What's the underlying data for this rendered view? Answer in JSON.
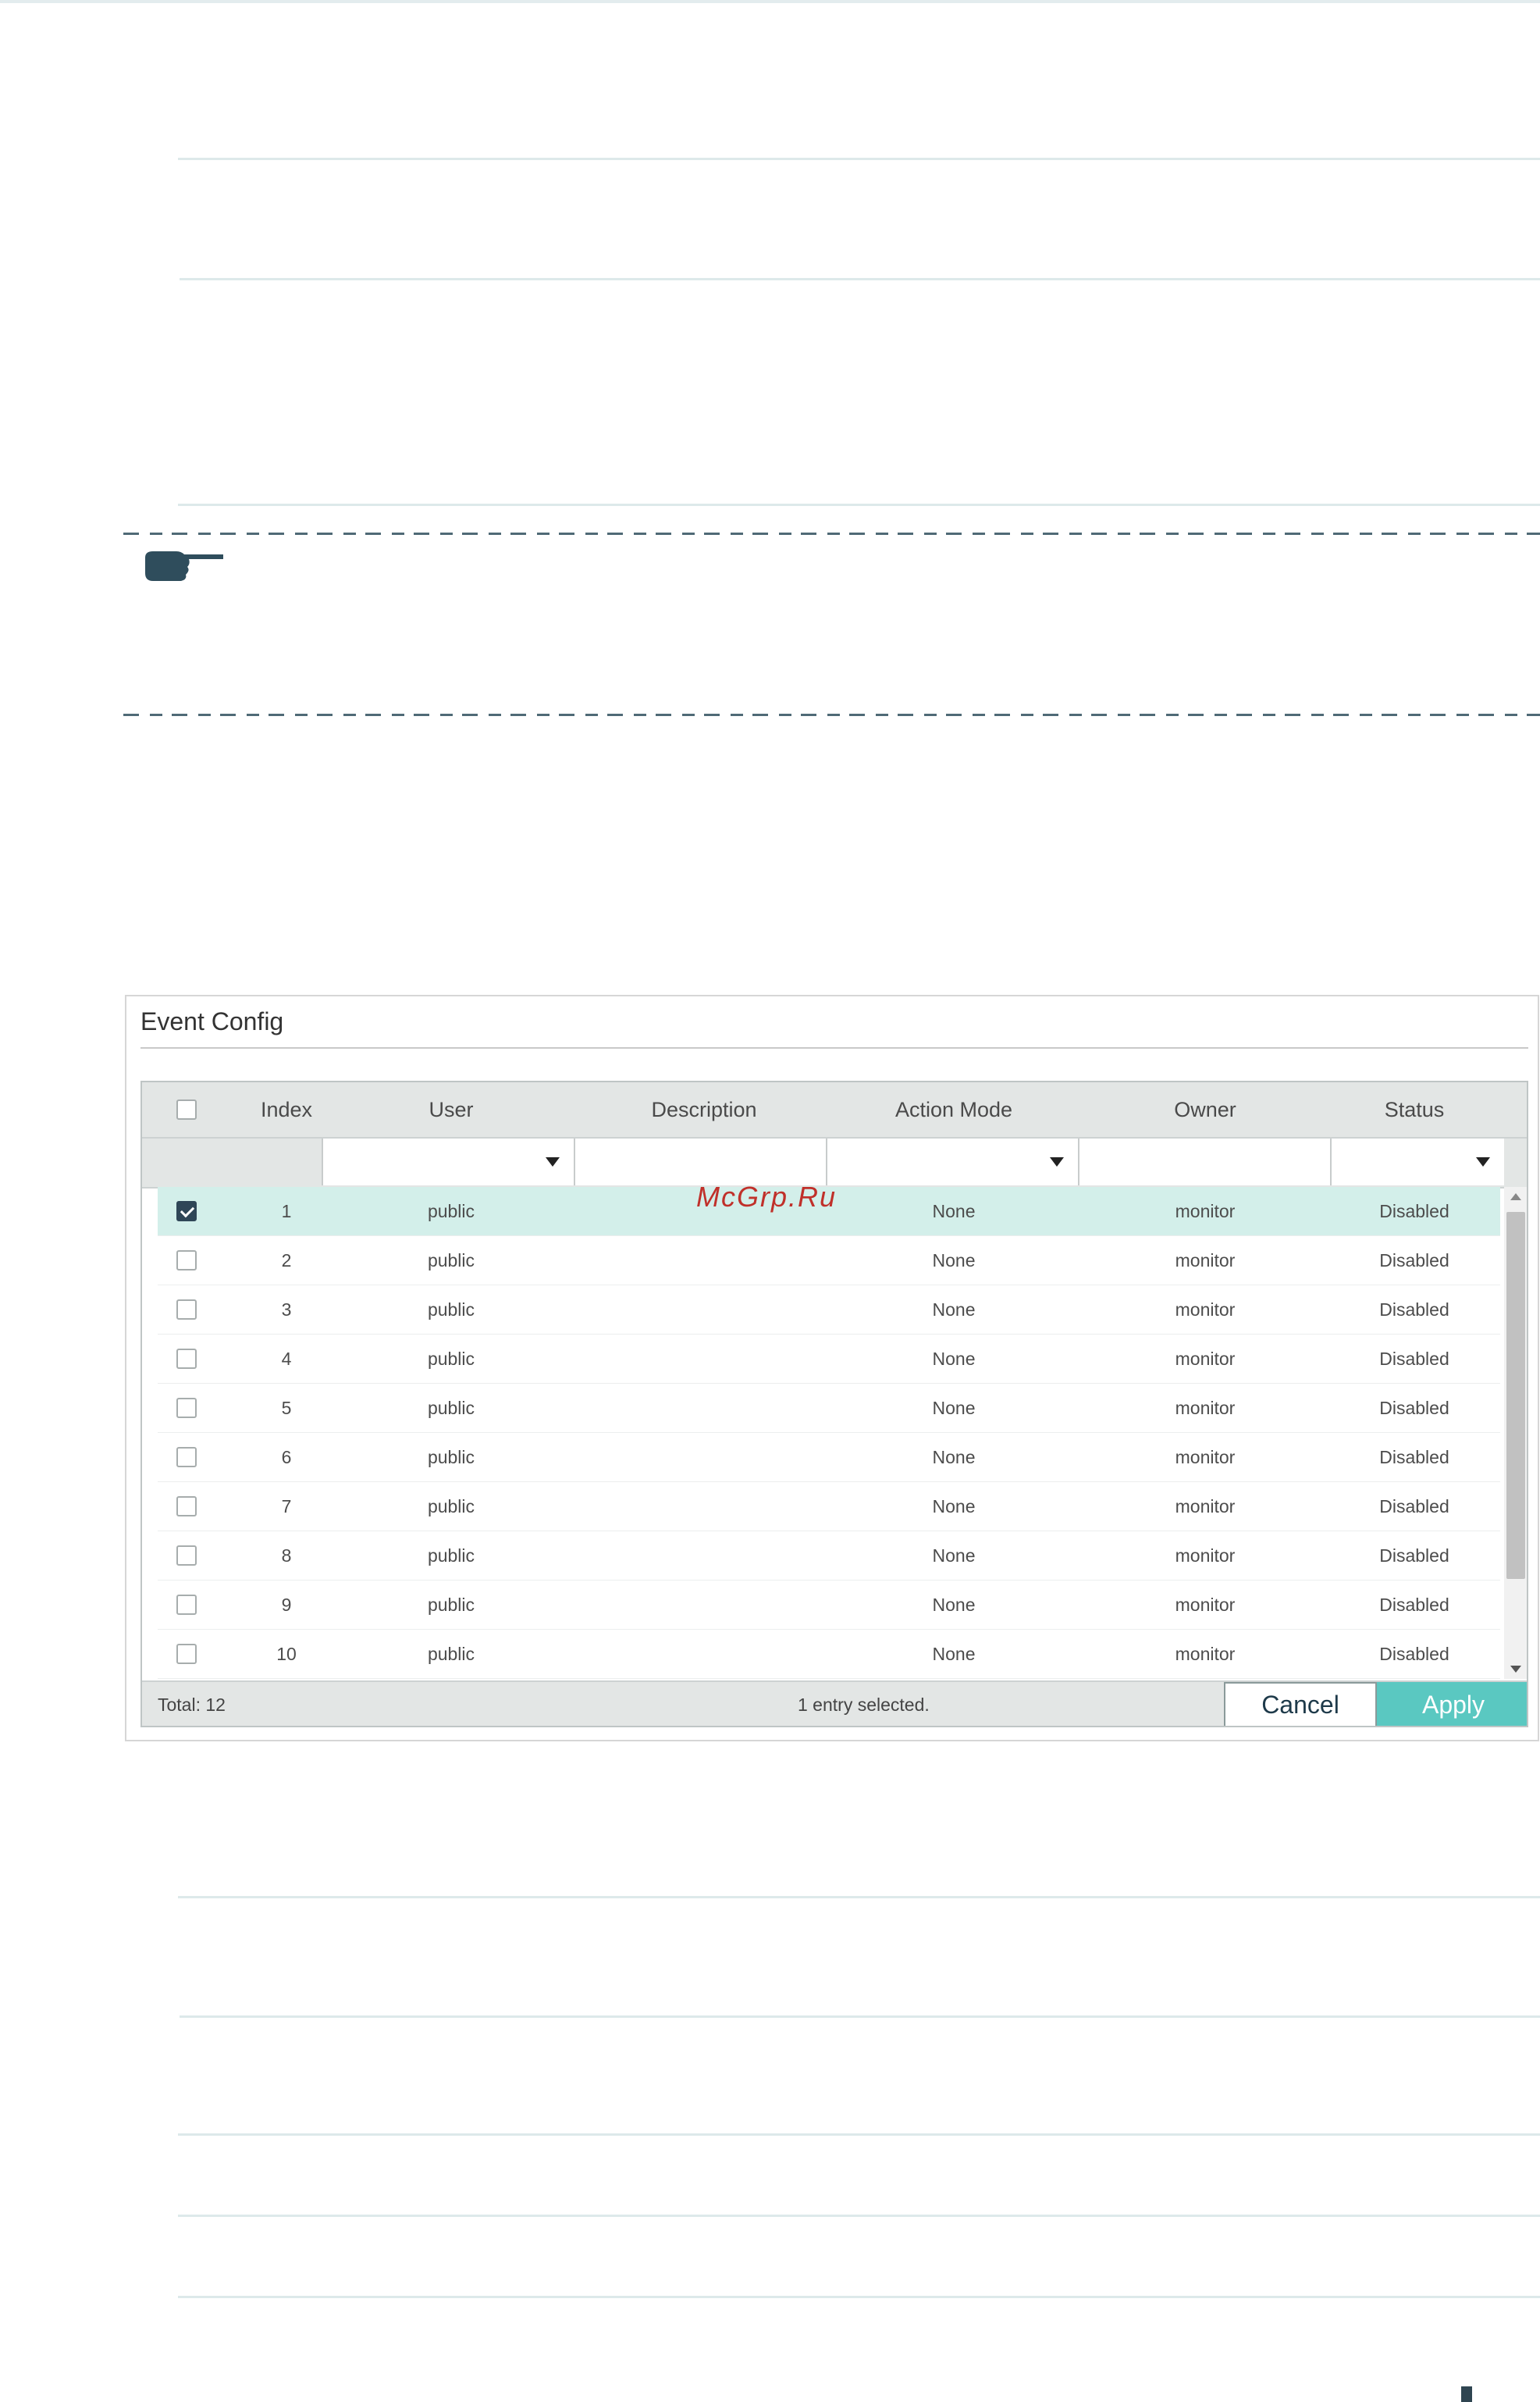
{
  "panel": {
    "title": "Event Config"
  },
  "table": {
    "columns": [
      "Index",
      "User",
      "Description",
      "Action Mode",
      "Owner",
      "Status"
    ],
    "rows": [
      {
        "index": "1",
        "user": "public",
        "description": "",
        "action_mode": "None",
        "owner": "monitor",
        "status": "Disabled",
        "checked": true
      },
      {
        "index": "2",
        "user": "public",
        "description": "",
        "action_mode": "None",
        "owner": "monitor",
        "status": "Disabled",
        "checked": false
      },
      {
        "index": "3",
        "user": "public",
        "description": "",
        "action_mode": "None",
        "owner": "monitor",
        "status": "Disabled",
        "checked": false
      },
      {
        "index": "4",
        "user": "public",
        "description": "",
        "action_mode": "None",
        "owner": "monitor",
        "status": "Disabled",
        "checked": false
      },
      {
        "index": "5",
        "user": "public",
        "description": "",
        "action_mode": "None",
        "owner": "monitor",
        "status": "Disabled",
        "checked": false
      },
      {
        "index": "6",
        "user": "public",
        "description": "",
        "action_mode": "None",
        "owner": "monitor",
        "status": "Disabled",
        "checked": false
      },
      {
        "index": "7",
        "user": "public",
        "description": "",
        "action_mode": "None",
        "owner": "monitor",
        "status": "Disabled",
        "checked": false
      },
      {
        "index": "8",
        "user": "public",
        "description": "",
        "action_mode": "None",
        "owner": "monitor",
        "status": "Disabled",
        "checked": false
      },
      {
        "index": "9",
        "user": "public",
        "description": "",
        "action_mode": "None",
        "owner": "monitor",
        "status": "Disabled",
        "checked": false
      },
      {
        "index": "10",
        "user": "public",
        "description": "",
        "action_mode": "None",
        "owner": "monitor",
        "status": "Disabled",
        "checked": false
      }
    ]
  },
  "footer": {
    "total": "Total: 12",
    "selection": "1 entry selected.",
    "cancel_label": "Cancel",
    "apply_label": "Apply"
  },
  "watermark": "McGrp.Ru",
  "colors": {
    "accent": "#5ac8c1",
    "selected_row": "#d3efea",
    "dark": "#2f4657"
  }
}
